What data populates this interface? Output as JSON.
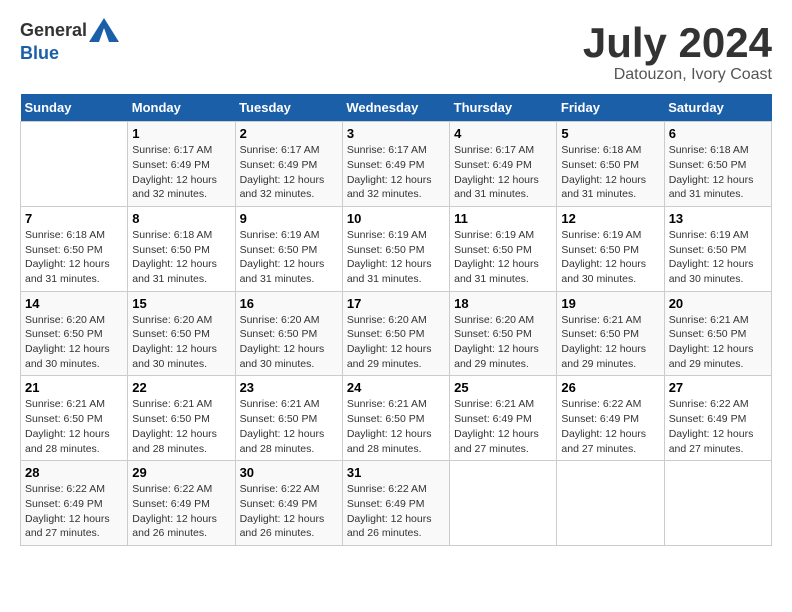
{
  "header": {
    "logo_general": "General",
    "logo_blue": "Blue",
    "title": "July 2024",
    "location": "Datouzon, Ivory Coast"
  },
  "calendar": {
    "days_of_week": [
      "Sunday",
      "Monday",
      "Tuesday",
      "Wednesday",
      "Thursday",
      "Friday",
      "Saturday"
    ],
    "weeks": [
      [
        {
          "date": "",
          "info": ""
        },
        {
          "date": "1",
          "info": "Sunrise: 6:17 AM\nSunset: 6:49 PM\nDaylight: 12 hours\nand 32 minutes."
        },
        {
          "date": "2",
          "info": "Sunrise: 6:17 AM\nSunset: 6:49 PM\nDaylight: 12 hours\nand 32 minutes."
        },
        {
          "date": "3",
          "info": "Sunrise: 6:17 AM\nSunset: 6:49 PM\nDaylight: 12 hours\nand 32 minutes."
        },
        {
          "date": "4",
          "info": "Sunrise: 6:17 AM\nSunset: 6:49 PM\nDaylight: 12 hours\nand 31 minutes."
        },
        {
          "date": "5",
          "info": "Sunrise: 6:18 AM\nSunset: 6:50 PM\nDaylight: 12 hours\nand 31 minutes."
        },
        {
          "date": "6",
          "info": "Sunrise: 6:18 AM\nSunset: 6:50 PM\nDaylight: 12 hours\nand 31 minutes."
        }
      ],
      [
        {
          "date": "7",
          "info": "Sunrise: 6:18 AM\nSunset: 6:50 PM\nDaylight: 12 hours\nand 31 minutes."
        },
        {
          "date": "8",
          "info": "Sunrise: 6:18 AM\nSunset: 6:50 PM\nDaylight: 12 hours\nand 31 minutes."
        },
        {
          "date": "9",
          "info": "Sunrise: 6:19 AM\nSunset: 6:50 PM\nDaylight: 12 hours\nand 31 minutes."
        },
        {
          "date": "10",
          "info": "Sunrise: 6:19 AM\nSunset: 6:50 PM\nDaylight: 12 hours\nand 31 minutes."
        },
        {
          "date": "11",
          "info": "Sunrise: 6:19 AM\nSunset: 6:50 PM\nDaylight: 12 hours\nand 31 minutes."
        },
        {
          "date": "12",
          "info": "Sunrise: 6:19 AM\nSunset: 6:50 PM\nDaylight: 12 hours\nand 30 minutes."
        },
        {
          "date": "13",
          "info": "Sunrise: 6:19 AM\nSunset: 6:50 PM\nDaylight: 12 hours\nand 30 minutes."
        }
      ],
      [
        {
          "date": "14",
          "info": "Sunrise: 6:20 AM\nSunset: 6:50 PM\nDaylight: 12 hours\nand 30 minutes."
        },
        {
          "date": "15",
          "info": "Sunrise: 6:20 AM\nSunset: 6:50 PM\nDaylight: 12 hours\nand 30 minutes."
        },
        {
          "date": "16",
          "info": "Sunrise: 6:20 AM\nSunset: 6:50 PM\nDaylight: 12 hours\nand 30 minutes."
        },
        {
          "date": "17",
          "info": "Sunrise: 6:20 AM\nSunset: 6:50 PM\nDaylight: 12 hours\nand 29 minutes."
        },
        {
          "date": "18",
          "info": "Sunrise: 6:20 AM\nSunset: 6:50 PM\nDaylight: 12 hours\nand 29 minutes."
        },
        {
          "date": "19",
          "info": "Sunrise: 6:21 AM\nSunset: 6:50 PM\nDaylight: 12 hours\nand 29 minutes."
        },
        {
          "date": "20",
          "info": "Sunrise: 6:21 AM\nSunset: 6:50 PM\nDaylight: 12 hours\nand 29 minutes."
        }
      ],
      [
        {
          "date": "21",
          "info": "Sunrise: 6:21 AM\nSunset: 6:50 PM\nDaylight: 12 hours\nand 28 minutes."
        },
        {
          "date": "22",
          "info": "Sunrise: 6:21 AM\nSunset: 6:50 PM\nDaylight: 12 hours\nand 28 minutes."
        },
        {
          "date": "23",
          "info": "Sunrise: 6:21 AM\nSunset: 6:50 PM\nDaylight: 12 hours\nand 28 minutes."
        },
        {
          "date": "24",
          "info": "Sunrise: 6:21 AM\nSunset: 6:50 PM\nDaylight: 12 hours\nand 28 minutes."
        },
        {
          "date": "25",
          "info": "Sunrise: 6:21 AM\nSunset: 6:49 PM\nDaylight: 12 hours\nand 27 minutes."
        },
        {
          "date": "26",
          "info": "Sunrise: 6:22 AM\nSunset: 6:49 PM\nDaylight: 12 hours\nand 27 minutes."
        },
        {
          "date": "27",
          "info": "Sunrise: 6:22 AM\nSunset: 6:49 PM\nDaylight: 12 hours\nand 27 minutes."
        }
      ],
      [
        {
          "date": "28",
          "info": "Sunrise: 6:22 AM\nSunset: 6:49 PM\nDaylight: 12 hours\nand 27 minutes."
        },
        {
          "date": "29",
          "info": "Sunrise: 6:22 AM\nSunset: 6:49 PM\nDaylight: 12 hours\nand 26 minutes."
        },
        {
          "date": "30",
          "info": "Sunrise: 6:22 AM\nSunset: 6:49 PM\nDaylight: 12 hours\nand 26 minutes."
        },
        {
          "date": "31",
          "info": "Sunrise: 6:22 AM\nSunset: 6:49 PM\nDaylight: 12 hours\nand 26 minutes."
        },
        {
          "date": "",
          "info": ""
        },
        {
          "date": "",
          "info": ""
        },
        {
          "date": "",
          "info": ""
        }
      ]
    ]
  }
}
